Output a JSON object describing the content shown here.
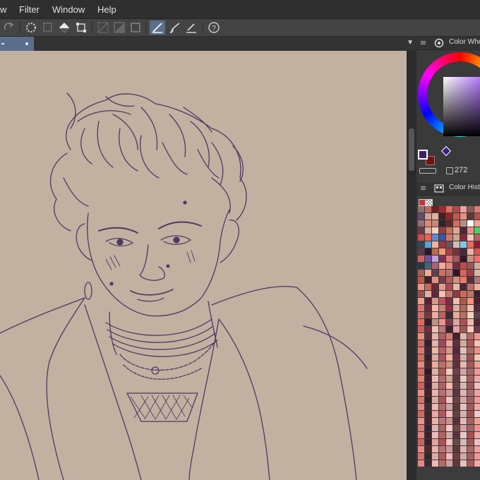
{
  "menubar": {
    "items": [
      "w",
      "Filter",
      "Window",
      "Help"
    ]
  },
  "toolbar": {
    "icons": [
      "redo-icon",
      "select-all-icon",
      "deselect-icon",
      "fill-icon",
      "transform-icon",
      "ruler-icon",
      "gradient-icon",
      "frame-icon",
      "pen-tool-icon",
      "brush-tool-icon",
      "eraser-tool-icon",
      "help-icon"
    ],
    "active_tool": "pen-tool-icon"
  },
  "panels": {
    "color_wheel": {
      "title": "Color Whe",
      "readout": "272"
    },
    "color_history": {
      "title": "Color Histo"
    }
  },
  "colors": {
    "canvas_bg": "#c2b0a1",
    "stroke": "#4e3a62",
    "main_color": "#3a1f6b",
    "sub_color": "#7a0f12",
    "active_tab": "#5b6f8c"
  },
  "history_swatches": [
    "#8e6f6f",
    "#c06860",
    "#702020",
    "#a52a2a",
    "#e07060",
    "#b04a4a",
    "#f0a0a0",
    "#8a5a5a",
    "#d88070",
    "#603030",
    "#c07070",
    "#6a4a6a",
    "#d0a090",
    "#e0b0a0",
    "#402020",
    "#902828",
    "#c05858",
    "#e89080",
    "#5a3838",
    "#b05050",
    "#f4c0b0",
    "#783030",
    "#9a7070",
    "#e08878",
    "#c88878",
    "#302030",
    "#602828",
    "#d86860",
    "#b89080",
    "#ffffff",
    "#f0a098",
    "#a84848",
    "#583040",
    "#703848",
    "#d8b0a0",
    "#f8d0c0",
    "#904040",
    "#c87058",
    "#e0a898",
    "#502838",
    "#f09080",
    "#48d060",
    "#d87878",
    "#a07060",
    "#c85050",
    "#f06050",
    "#6088d0",
    "#3858a0",
    "#d07868",
    "#c8a890",
    "#882838",
    "#e8c8b8",
    "#b86060",
    "#402838",
    "#e09888",
    "#304858",
    "#58a0d8",
    "#f8b098",
    "#a03838",
    "#705060",
    "#d0c0b0",
    "#80c8e8",
    "#f06860",
    "#902030",
    "#c07878",
    "#e8a090",
    "#603848",
    "#281828",
    "#c06848",
    "#f89878",
    "#b04040",
    "#7a3040",
    "#4a2838",
    "#e8b0a0",
    "#d05850",
    "#f0d0c0",
    "#382030",
    "#d06060",
    "#7050a0",
    "#c0a0e0",
    "#803050",
    "#e07878",
    "#a85858",
    "#301830",
    "#c89080",
    "#f07070",
    "#582838",
    "#e0c0b0",
    "#283848",
    "#406878",
    "#b06070",
    "#f0a8a0",
    "#e88878",
    "#703040",
    "#c84848",
    "#985858",
    "#d8a8a0",
    "#482030",
    "#f0b8a8",
    "#a86050",
    "#f8a890",
    "#604050",
    "#d07060",
    "#b87070",
    "#301820",
    "#e06060",
    "#a04050",
    "#d8b8a8",
    "#886070",
    "#f0c8b8",
    "#c05848",
    "#402030",
    "#e89080",
    "#783848",
    "#b85858",
    "#d09080",
    "#f07868",
    "#583040",
    "#a87878",
    "#e0a0a0",
    "#301828",
    "#f09888",
    "#c86858",
    "#702838",
    "#d8a090",
    "#b04850",
    "#e8b8a8",
    "#482838",
    "#c07060",
    "#f0b0a0",
    "#884050",
    "#d87060",
    "#a05050",
    "#e0b0a8",
    "#602838",
    "#f8c0b0",
    "#c87868",
    "#903848",
    "#d06858",
    "#b87868",
    "#402028",
    "#e89898",
    "#a86868",
    "#f0a090",
    "#582030",
    "#d89888",
    "#c05060",
    "#783040",
    "#e8c0b0",
    "#b05848",
    "#f09080",
    "#482030",
    "#d0a898",
    "#a04848",
    "#e07070",
    "#683040",
    "#f8b8a8",
    "#c88070",
    "#903040",
    "#d8b0a0",
    "#b06858",
    "#f0c0b0",
    "#582838",
    "#e09080",
    "#a85050",
    "#d07070",
    "#783838",
    "#f0a8a0",
    "#c06060",
    "#402830",
    "#e8a898",
    "#b87060",
    "#f8d0c0",
    "#604048",
    "#d89080",
    "#a06060",
    "#e86860",
    "#302028",
    "#c09080",
    "#f09090",
    "#803848",
    "#d8a8a0",
    "#b05050",
    "#f0b8b0",
    "#502830",
    "#e0a090",
    "#986060",
    "#c86060",
    "#703040",
    "#f0c0b0",
    "#b87878",
    "#402028",
    "#e8a0a0",
    "#a05858",
    "#f8c8b8",
    "#683848",
    "#d09888",
    "#c05858",
    "#e89080",
    "#583038",
    "#f0b0a8",
    "#a86060",
    "#d87870",
    "#482030",
    "#e0b8a8",
    "#b86868",
    "#f09888",
    "#783848",
    "#c08070",
    "#d06868",
    "#302030",
    "#e8b0a8",
    "#a04858",
    "#f0a0a0",
    "#603040",
    "#d8a898",
    "#b05858",
    "#f8c0b8",
    "#884048",
    "#c87070",
    "#e07878",
    "#402838",
    "#f0b8a8",
    "#b86060",
    "#d89890",
    "#582838",
    "#e8c0b8",
    "#a86868",
    "#f09080",
    "#703848",
    "#c09888",
    "#d07060",
    "#382028",
    "#e0a8a0",
    "#b05060",
    "#f8b0a0",
    "#683040",
    "#d8b0a8",
    "#a05050",
    "#f0c8b8",
    "#804048",
    "#c87868",
    "#e88880",
    "#482830",
    "#f0a898",
    "#b87068",
    "#d09080",
    "#603038",
    "#e8b8b0",
    "#a85858",
    "#f0a090",
    "#783040",
    "#c8a090",
    "#d86868",
    "#301828",
    "#e0b0a0",
    "#b05858",
    "#f8c8c0",
    "#704048",
    "#d8a0a0",
    "#a06868",
    "#f09898",
    "#583030",
    "#c07870",
    "#e08070",
    "#402030",
    "#f0b8b8",
    "#b86870",
    "#d0a090",
    "#603840",
    "#e8c8c0",
    "#a86060",
    "#f0a8a8",
    "#783838",
    "#c89888",
    "#d06060",
    "#382030",
    "#e8a8a0",
    "#b06060",
    "#f8b8b0",
    "#684048",
    "#d8b8b0",
    "#a05858",
    "#f0c0c0",
    "#804040",
    "#c08878",
    "#e89088",
    "#482028",
    "#f0b0b0",
    "#b87070",
    "#d09898",
    "#583840",
    "#e8b0b0",
    "#a86868",
    "#f0a0a8",
    "#703838",
    "#c8a098",
    "#d87070",
    "#302028",
    "#e0a8a8",
    "#b05050",
    "#f8c0c0",
    "#704040",
    "#d8a8a8",
    "#a06060",
    "#f09898",
    "#583838",
    "#c09090",
    "#e08888",
    "#402830",
    "#f0b8b0",
    "#b86868",
    "#d0a0a0",
    "#603838",
    "#e8c0c0",
    "#a85858",
    "#f0a8a0",
    "#783840",
    "#c89898",
    "#d06868",
    "#382828",
    "#e8a8a8",
    "#b05858",
    "#f8b8b8",
    "#684040",
    "#d8b0b0",
    "#a05050",
    "#f0c8c8",
    "#804848",
    "#c08080",
    "#e89090",
    "#482030",
    "#f0b0a8",
    "#b87878",
    "#d09090",
    "#583038",
    "#e8b8b8",
    "#a86060",
    "#f0a090",
    "#703030",
    "#c8a0a0",
    "#d87878",
    "#302030",
    "#e0b0b0",
    "#b06060",
    "#f8c8c8",
    "#704848",
    "#d8a0a0",
    "#a06868",
    "#f09090",
    "#583030",
    "#c07878",
    "#e08080",
    "#402028",
    "#f0b8b8",
    "#b86060",
    "#d0a8a8",
    "#603040",
    "#e8c8c8",
    "#a85050",
    "#f0a8a8",
    "#783030",
    "#c89090",
    "#d06060",
    "#382030",
    "#e8a0a0",
    "#b05050",
    "#f8c0c0",
    "#684848",
    "#d8b8b8",
    "#a05858",
    "#f0c0c0",
    "#804040",
    "#c08888",
    "#e88888",
    "#482828",
    "#f0b0b0",
    "#b87070",
    "#d09898",
    "#583838",
    "#e8b0b0",
    "#a86868",
    "#f0a0a0",
    "#703838",
    "#c8a8a8",
    "#d87070",
    "#302828",
    "#e0a8a8",
    "#b05858",
    "#f8b8b8",
    "#704040",
    "#d8a8a8",
    "#a06060",
    "#f09898",
    "#583838",
    "#c09898",
    "#e08888",
    "#402830",
    "#f0b8b8",
    "#b86868",
    "#d0a0a0",
    "#603838",
    "#e8c0c0",
    "#a85858",
    "#f0a8a8",
    "#783838",
    "#c89898"
  ]
}
